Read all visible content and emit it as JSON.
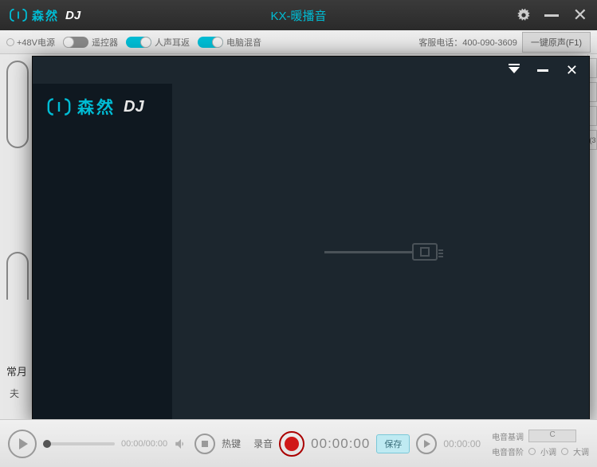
{
  "titlebar": {
    "brand": "森然",
    "brand_dj": "DJ",
    "title": "KX-暖播音"
  },
  "toolbar": {
    "phantom": "+48V电源",
    "remote": "遥控器",
    "vocal_monitor": "人声耳返",
    "pc_mix": "电脑混音",
    "service_phone": "客服电话：400-090-3609",
    "original_btn": "一键原声(F1)"
  },
  "side": {
    "category_label": "常月",
    "category_item": "夫"
  },
  "overlay": {
    "brand": "森然",
    "brand_dj": "DJ"
  },
  "bottom": {
    "play_time": "00:00/00:00",
    "hotkey": "热键",
    "rec_label": "录音",
    "rec_time": "00:00:00",
    "save": "保存",
    "rec_time2": "00:00:00",
    "tune_base": "电音基调",
    "tune_key": "C",
    "tune_step": "电音音阶",
    "minor": "小调",
    "major": "大调"
  },
  "edge": {
    "x3": "(3"
  }
}
